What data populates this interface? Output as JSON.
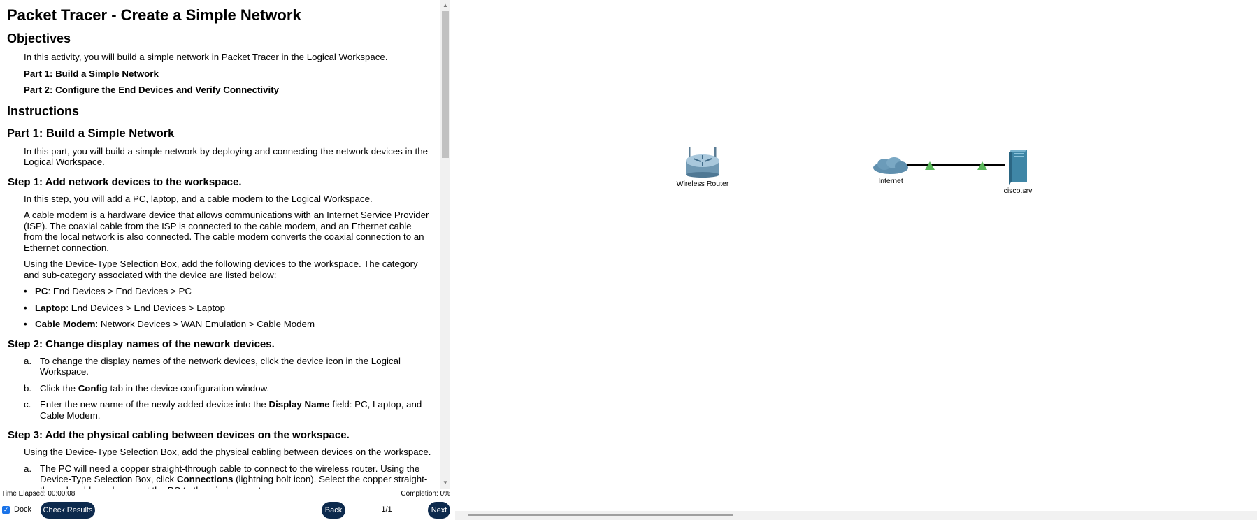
{
  "doc": {
    "title": "Packet Tracer - Create a Simple Network",
    "objectives_heading": "Objectives",
    "objectives_intro": "In this activity, you will build a simple network in Packet Tracer in the Logical Workspace.",
    "part1_label": "Part 1: Build a Simple Network",
    "part2_label": "Part 2: Configure the End Devices and Verify Connectivity",
    "instructions_heading": "Instructions",
    "part1_heading": "Part 1: Build a Simple Network",
    "part1_intro": "In this part, you will build a simple network by deploying and connecting the network devices in the Logical Workspace.",
    "step1_heading": "Step 1: Add network devices to the workspace.",
    "step1_p1": "In this step, you will add a PC, laptop, and a cable modem to the Logical Workspace.",
    "step1_p2": "A cable modem is a hardware device that allows communications with an Internet Service Provider (ISP). The coaxial cable from the ISP is connected to the cable modem, and an Ethernet cable from the local network is also connected. The cable modem converts the coaxial connection to an Ethernet connection.",
    "step1_p3": "Using the Device-Type Selection Box, add the following devices to the workspace. The category and sub-category associated with the device are listed below:",
    "bullets": [
      {
        "name": "PC",
        "text": ": End Devices > End Devices > PC"
      },
      {
        "name": "Laptop",
        "text": ": End Devices > End Devices > Laptop"
      },
      {
        "name": "Cable Modem",
        "text": ": Network Devices > WAN Emulation > Cable Modem"
      }
    ],
    "step2_heading": "Step 2: Change display names of the nework devices.",
    "step2_a_label": "a.",
    "step2_a": "To change the display names of the network devices, click the device icon in the Logical Workspace.",
    "step2_b_label": "b.",
    "step2_b_pre": "Click the ",
    "step2_b_bold": "Config",
    "step2_b_post": " tab in the device configuration window.",
    "step2_c_label": "c.",
    "step2_c_pre": "Enter the new name of the newly added device into the ",
    "step2_c_bold": "Display Name",
    "step2_c_post": " field: PC, Laptop, and Cable Modem.",
    "step3_heading": "Step 3: Add the physical cabling between devices on the workspace.",
    "step3_p1": "Using the Device-Type Selection Box, add the physical cabling between devices on the workspace.",
    "step3_a_label": "a.",
    "step3_a_pre": "The PC will need a copper straight-through cable to connect to the wireless router. Using the Device-Type Selection Box, click ",
    "step3_a_bold": "Connections",
    "step3_a_post": " (lightning bolt icon). Select the copper straight-through cable and connect the PC to the wireless router."
  },
  "status": {
    "time_elapsed": "Time Elapsed: 00:00:08",
    "completion": "Completion: 0%"
  },
  "controls": {
    "dock_label": "Dock",
    "check_results_label": "Check Results",
    "back_label": "Back",
    "page_number": "1/1",
    "next_label": "Next"
  },
  "workspace": {
    "devices": [
      {
        "name": "Wireless Router"
      },
      {
        "name": "Internet"
      },
      {
        "name": "cisco.srv"
      }
    ],
    "link_status_color": "#5cb85c"
  }
}
